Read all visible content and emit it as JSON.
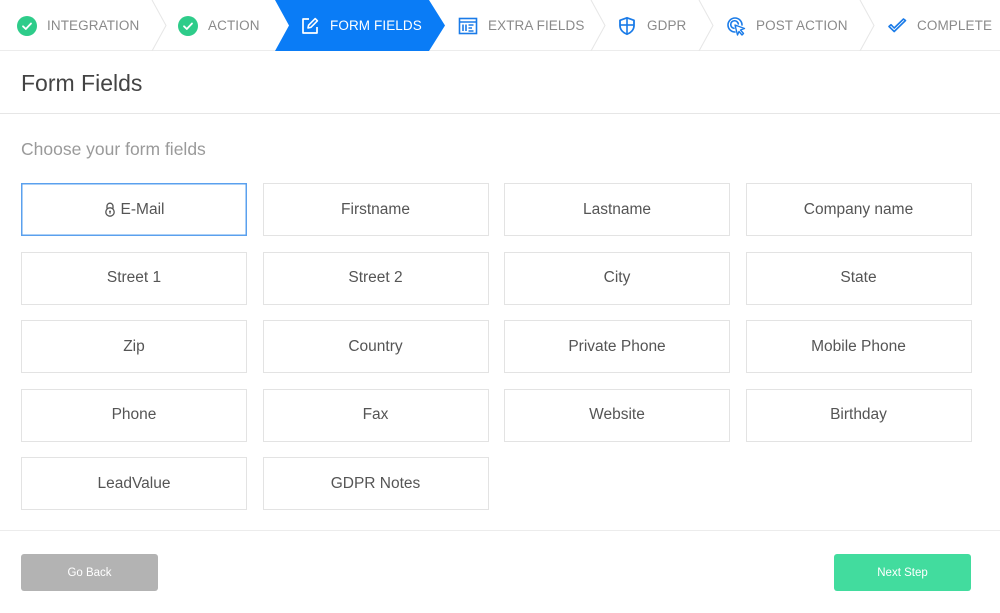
{
  "stepper": {
    "steps": [
      {
        "label": "Integration",
        "state": "done",
        "icon": "check-circle-icon"
      },
      {
        "label": "Action",
        "state": "done",
        "icon": "check-circle-icon"
      },
      {
        "label": "Form Fields",
        "state": "active",
        "icon": "edit-icon"
      },
      {
        "label": "Extra Fields",
        "state": "pending",
        "icon": "form-list-icon"
      },
      {
        "label": "GDPR",
        "state": "pending",
        "icon": "shield-icon"
      },
      {
        "label": "Post Action",
        "state": "pending",
        "icon": "cursor-click-icon"
      },
      {
        "label": "Complete",
        "state": "pending",
        "icon": "checkmark-icon"
      }
    ]
  },
  "colors": {
    "active_step": "#0a7cf6",
    "done_check": "#2ecc8a",
    "icon_blue": "#1a7be8",
    "selected_border": "#5aa0ee",
    "back_button": "#b3b3b3",
    "next_button": "#42dc9e"
  },
  "page": {
    "title": "Form Fields",
    "subtitle": "Choose your form fields"
  },
  "fields": [
    {
      "label": "E-Mail",
      "selected": true,
      "locked": true
    },
    {
      "label": "Firstname",
      "selected": false
    },
    {
      "label": "Lastname",
      "selected": false
    },
    {
      "label": "Company name",
      "selected": false
    },
    {
      "label": "Street 1",
      "selected": false
    },
    {
      "label": "Street 2",
      "selected": false
    },
    {
      "label": "City",
      "selected": false
    },
    {
      "label": "State",
      "selected": false
    },
    {
      "label": "Zip",
      "selected": false
    },
    {
      "label": "Country",
      "selected": false
    },
    {
      "label": "Private Phone",
      "selected": false
    },
    {
      "label": "Mobile Phone",
      "selected": false
    },
    {
      "label": "Phone",
      "selected": false
    },
    {
      "label": "Fax",
      "selected": false
    },
    {
      "label": "Website",
      "selected": false
    },
    {
      "label": "Birthday",
      "selected": false
    },
    {
      "label": "LeadValue",
      "selected": false
    },
    {
      "label": "GDPR Notes",
      "selected": false
    }
  ],
  "footer": {
    "back_label": "Go Back",
    "next_label": "Next Step"
  }
}
